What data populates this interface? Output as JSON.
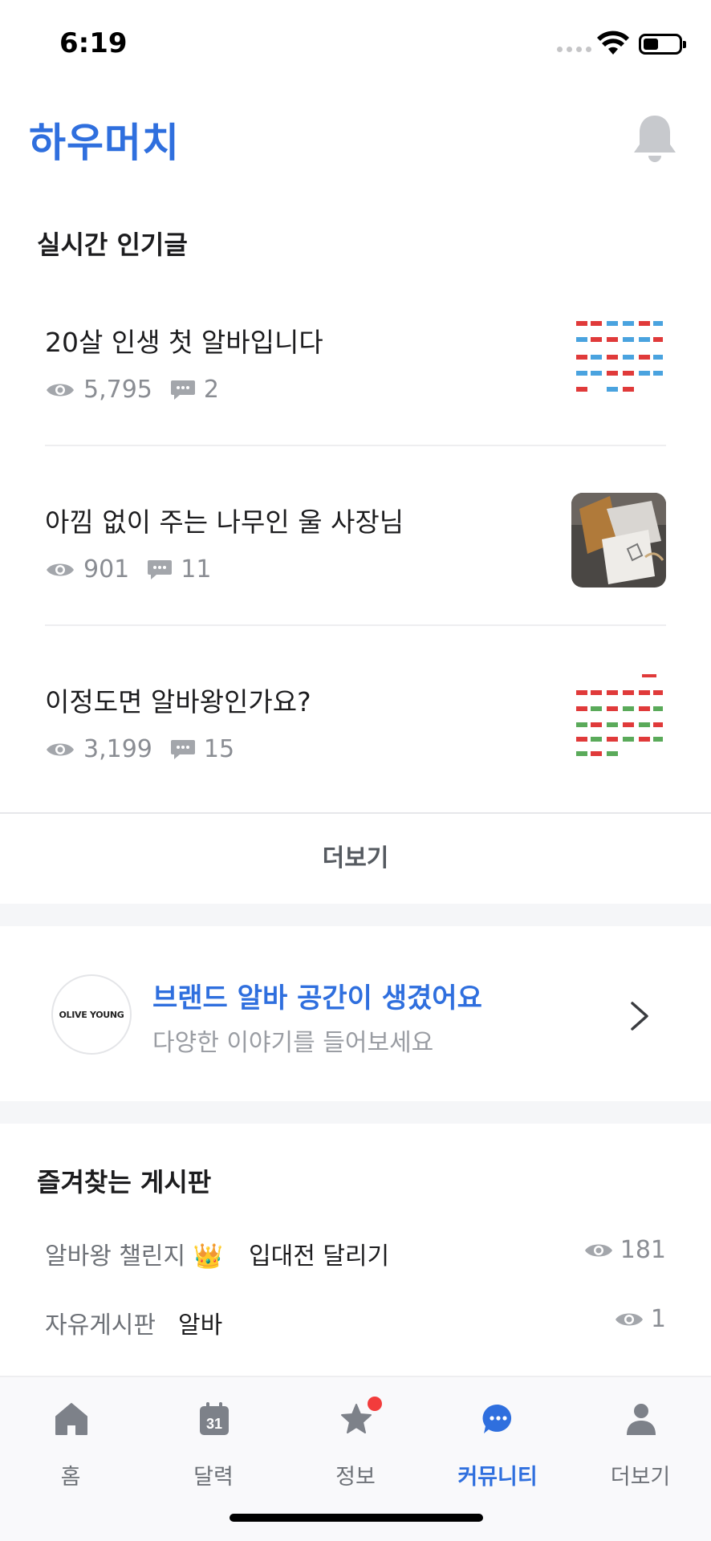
{
  "status": {
    "time": "6:19"
  },
  "header": {
    "app_name": "하우머치"
  },
  "popular": {
    "title": "실시간 인기글",
    "posts": [
      {
        "title": "20살 인생 첫 알바입니다",
        "views": "5,795",
        "comments": "2",
        "thumb": "calendar-schedule"
      },
      {
        "title": "아낌 없이 주는 나무인 울 사장님",
        "views": "901",
        "comments": "11",
        "thumb": "gift-photo"
      },
      {
        "title": "이정도면 알바왕인가요?",
        "views": "3,199",
        "comments": "15",
        "thumb": "calendar-schedule"
      }
    ],
    "more_label": "더보기"
  },
  "brand_banner": {
    "logo_text": "OLIVE YOUNG",
    "title": "브랜드 알바 공간이 생겼어요",
    "subtitle": "다양한 이야기를 들어보세요"
  },
  "favorites": {
    "title": "즐겨찾는 게시판",
    "rows": [
      {
        "board": "알바왕 챌린지 👑",
        "post": "입대전 달리기",
        "views": "181"
      },
      {
        "board": "자유게시판",
        "post": "알바",
        "views": "1"
      }
    ]
  },
  "tabs": [
    {
      "label": "홈",
      "icon": "home-icon"
    },
    {
      "label": "달력",
      "icon": "calendar-icon",
      "calendar_day": "31"
    },
    {
      "label": "정보",
      "icon": "star-icon",
      "badge": true
    },
    {
      "label": "커뮤니티",
      "icon": "chat-bubble-icon",
      "active": true
    },
    {
      "label": "더보기",
      "icon": "person-icon"
    }
  ],
  "colors": {
    "accent": "#2f6fde",
    "text": "#1c1c1e",
    "muted": "#8a8d93",
    "badge": "#f23c3c"
  }
}
